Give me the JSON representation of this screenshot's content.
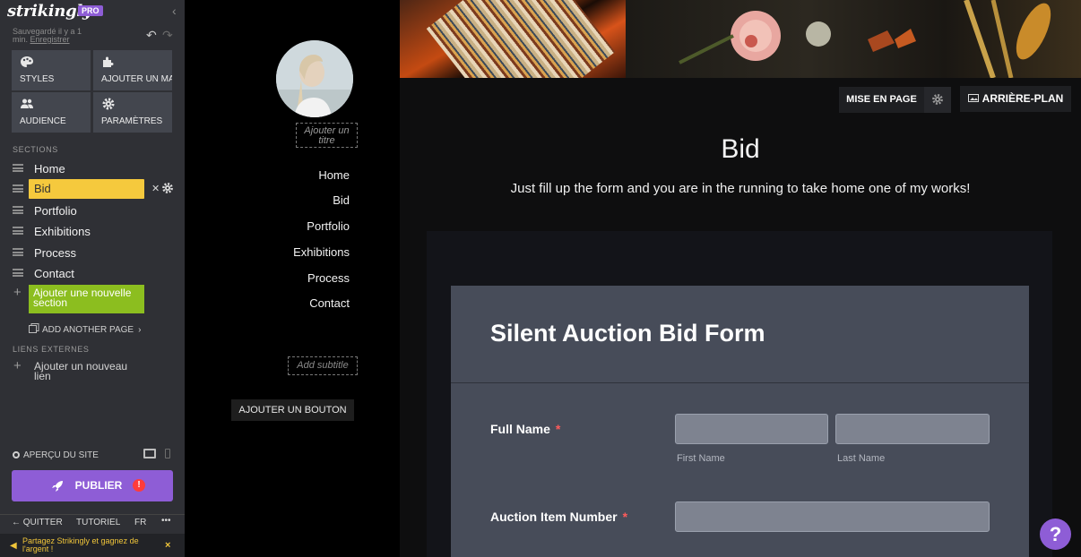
{
  "editor": {
    "logo": "strikingly",
    "badge": "PRO",
    "saved_text": "Sauvegardé il y a 1 min.",
    "save_link": "Enregistrer",
    "tools": {
      "styles": "STYLES",
      "add_app": "AJOUTER UN MA",
      "audience": "AUDIENCE",
      "settings": "PARAMÈTRES"
    },
    "sections_heading": "SECTIONS",
    "sections": [
      "Home",
      "Bid",
      "Portfolio",
      "Exhibitions",
      "Process",
      "Contact"
    ],
    "active_section": "Bid",
    "add_section": "Ajouter une nouvelle section",
    "add_page": "ADD ANOTHER PAGE",
    "links_heading": "LIENS EXTERNES",
    "add_link": "Ajouter un nouveau lien",
    "preview": "APERÇU DU SITE",
    "publish": "PUBLIER",
    "publish_alert": "!",
    "quit": "QUITTER",
    "tutorial": "TUTORIEL",
    "language": "FR",
    "more": "•••",
    "promo": "Partagez Strikingly et gagnez de l'argent !",
    "promo_close": "×"
  },
  "site": {
    "add_title": "Ajouter un titre",
    "nav": [
      "Home",
      "Bid",
      "Portfolio",
      "Exhibitions",
      "Process",
      "Contact"
    ],
    "add_subtitle": "Add subtitle",
    "add_button": "AJOUTER UN BOUTON"
  },
  "main": {
    "layout_button": "MISE EN PAGE",
    "background_button": "ARRIÈRE-PLAN",
    "heading": "Bid",
    "subheading": "Just fill up the form and you are in the running to take home one of my works!"
  },
  "form": {
    "title": "Silent Auction Bid Form",
    "fields": [
      {
        "label": "Full Name",
        "required": "*",
        "hints": [
          "First Name",
          "Last Name"
        ]
      },
      {
        "label": "Auction Item Number",
        "required": "*"
      }
    ]
  },
  "help_button": "?",
  "colors": {
    "accent_purple": "#8e5dd6",
    "active_section": "#f5c93d",
    "add_section_green": "#8cbe1f",
    "form_card": "#474c59"
  }
}
